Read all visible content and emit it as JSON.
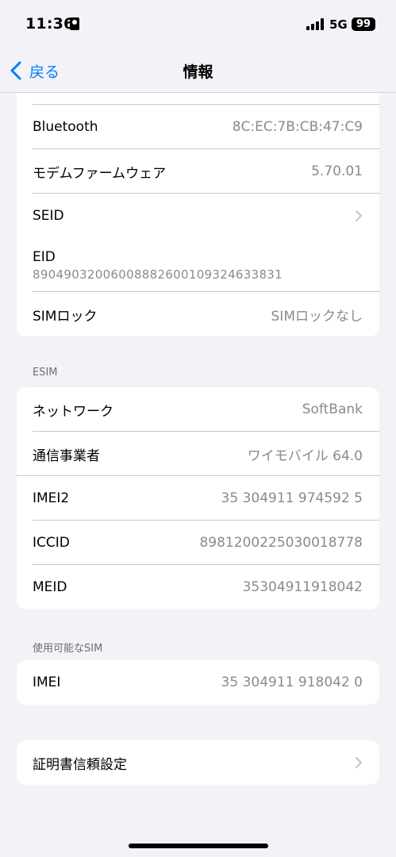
{
  "status_bar": {
    "time": "11:36",
    "network": "5G",
    "battery": "99",
    "icons": [
      "id-card-icon",
      "signal-icon",
      "battery-icon"
    ]
  },
  "nav": {
    "back_label": "戻る",
    "title": "情報"
  },
  "group1": {
    "bluetooth": {
      "label": "Bluetooth",
      "value": "8C:EC:7B:CB:47:C9"
    },
    "modem": {
      "label": "モデムファームウェア",
      "value": "5.70.01"
    },
    "seid": {
      "label": "SEID"
    },
    "eid": {
      "label": "EID",
      "value": "89049032006008882600109324633831"
    },
    "simlock": {
      "label": "SIMロック",
      "value": "SIMロックなし"
    }
  },
  "esim": {
    "header": "ESIM",
    "network": {
      "label": "ネットワーク",
      "value": "SoftBank"
    },
    "carrier": {
      "label": "通信事業者",
      "value": "ワイモバイル 64.0"
    },
    "imei2": {
      "label": "IMEI2",
      "value": "35 304911 974592 5"
    },
    "iccid": {
      "label": "ICCID",
      "value": "8981200225030018778"
    },
    "meid": {
      "label": "MEID",
      "value": "35304911918042"
    }
  },
  "available_sim": {
    "header": "使用可能なSIM",
    "imei": {
      "label": "IMEI",
      "value": "35 304911 918042 0"
    }
  },
  "cert": {
    "label": "証明書信頼設定"
  },
  "colors": {
    "accent": "#007aff",
    "background": "#f2f2f7",
    "secondary_text": "#8a8a8e"
  }
}
